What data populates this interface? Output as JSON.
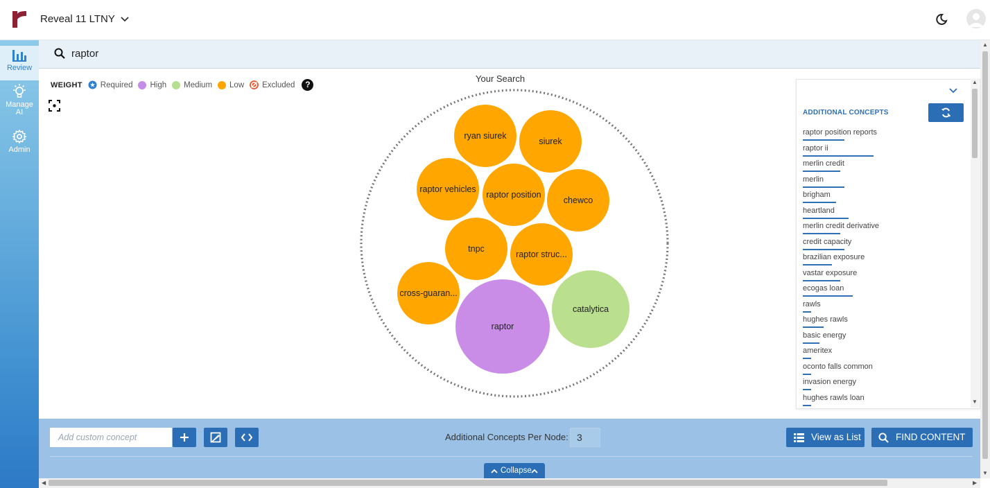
{
  "header": {
    "workspace": "Reveal 11 LTNY",
    "logo_color": "#8c2233"
  },
  "nav": {
    "items": [
      {
        "label": "Review",
        "icon": "bar-chart-icon"
      },
      {
        "label": "Manage AI",
        "icon": "lightbulb-icon"
      },
      {
        "label": "Admin",
        "icon": "gear-icon"
      }
    ]
  },
  "search": {
    "value": "raptor"
  },
  "legend": {
    "title": "WEIGHT",
    "items": [
      {
        "label": "Required",
        "color": "#2f80cf"
      },
      {
        "label": "High",
        "color": "#c58be8"
      },
      {
        "label": "Medium",
        "color": "#b8de8f"
      },
      {
        "label": "Low",
        "color": "#ffa500"
      },
      {
        "label": "Excluded",
        "color": "#e8542b"
      }
    ],
    "help": "?"
  },
  "map": {
    "title": "Your Search",
    "colors": {
      "low": "#ffa600",
      "high": "#c98de8",
      "medium": "#b9df8f"
    },
    "bubbles": [
      {
        "label": "ryan siurek",
        "weight": "low"
      },
      {
        "label": "siurek",
        "weight": "low"
      },
      {
        "label": "raptor vehicles",
        "weight": "low"
      },
      {
        "label": "raptor position",
        "weight": "low"
      },
      {
        "label": "chewco",
        "weight": "low"
      },
      {
        "label": "tnpc",
        "weight": "low"
      },
      {
        "label": "raptor struc...",
        "weight": "low"
      },
      {
        "label": "cross-guaran...",
        "weight": "low"
      },
      {
        "label": "raptor",
        "weight": "high"
      },
      {
        "label": "catalytica",
        "weight": "medium"
      }
    ]
  },
  "concepts": {
    "header": "ADDITIONAL CONCEPTS",
    "items": [
      "raptor position reports",
      "raptor ii",
      "merlin credit",
      "merlin",
      "brigham",
      "heartland",
      "merlin credit derivative",
      "credit capacity",
      "brazilian exposure",
      "vastar exposure",
      "ecogas loan",
      "rawls",
      "hughes rawls",
      "basic energy",
      "ameritex",
      "oconto falls common",
      "invasion energy",
      "hughes rawls loan"
    ],
    "underline_fractions": [
      0.5,
      0.85,
      0.45,
      0.5,
      0.4,
      0.55,
      0.45,
      0.5,
      0.35,
      0.45,
      0.6,
      0.1,
      0.25,
      0.2,
      0.1,
      0.1,
      0.1,
      0.1
    ]
  },
  "bottom": {
    "custom_placeholder": "Add custom concept",
    "acpn_label": "Additional Concepts Per Node:",
    "acpn_value": "3",
    "view_list": "View as List",
    "find_content": "FIND CONTENT",
    "collapse": "Collapse"
  }
}
